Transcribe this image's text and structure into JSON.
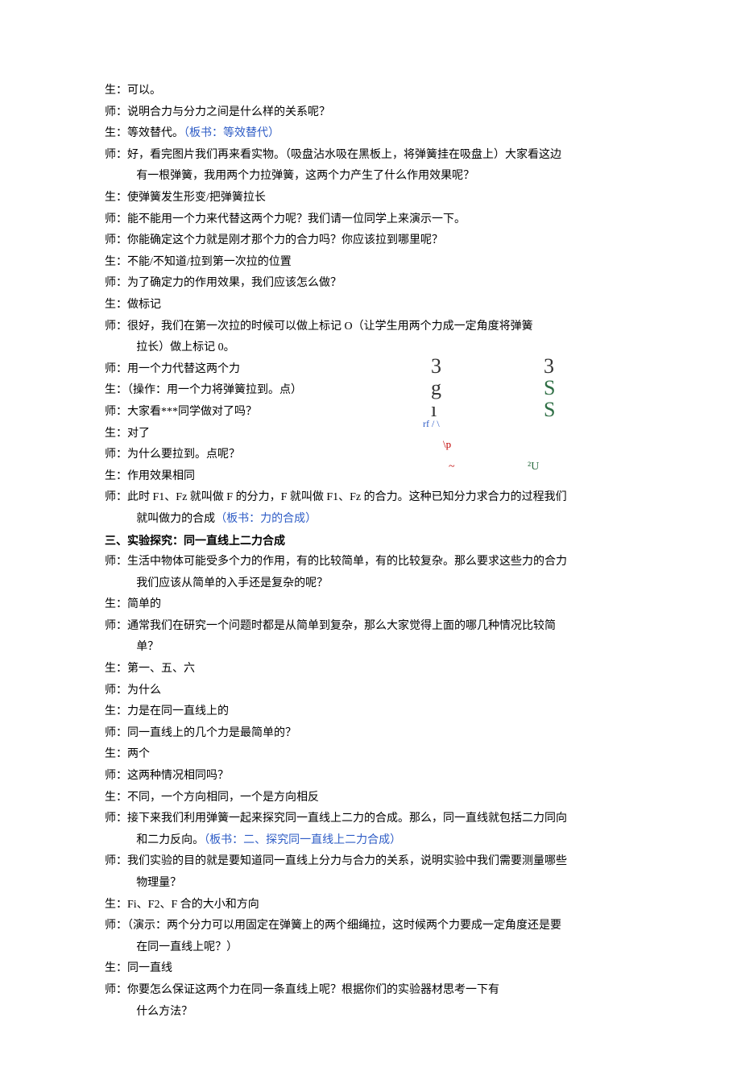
{
  "lines": [
    {
      "speaker": "生：",
      "text": "可以。"
    },
    {
      "speaker": "师：",
      "text": "说明合力与分力之间是什么样的关系呢？"
    },
    {
      "speaker": "生：",
      "text": "等效替代。",
      "blueSuffix": "（板书：等效替代）"
    },
    {
      "speaker": "师：",
      "text": "好，看完图片我们再来看实物。（吸盘沾水吸在黑板上，将弹簧挂在吸盘上）大家看这边"
    },
    {
      "indent": true,
      "text": "有一根弹簧，我用两个力拉弹簧，这两个力产生了什么作用效果呢？"
    },
    {
      "speaker": "生：",
      "text": "使弹簧发生形变/把弹簧拉长"
    },
    {
      "speaker": "师：",
      "text": "能不能用一个力来代替这两个力呢？我们请一位同学上来演示一下。"
    },
    {
      "speaker": "师：",
      "text": "你能确定这个力就是刚才那个力的合力吗？你应该拉到哪里呢？"
    },
    {
      "speaker": "生：",
      "text": "不能/不知道/拉到第一次拉的位置"
    },
    {
      "speaker": "师：",
      "text": "为了确定力的作用效果，我们应该怎么做？"
    },
    {
      "speaker": "生：",
      "text": "做标记"
    },
    {
      "speaker": "师：",
      "text": "很好，我们在第一次拉的时候可以做上标记 O（让学生用两个力成一定角度将弹簧"
    },
    {
      "indent": true,
      "text": "拉长）做上标记 0。"
    },
    {
      "speaker": "师：",
      "text": "用一个力代替这两个力"
    },
    {
      "speaker": "生：",
      "text": "（操作：用一个力将弹簧拉到。点）"
    },
    {
      "speaker": "师：",
      "text": "大家看***同学做对了吗？"
    },
    {
      "speaker": "生：",
      "text": "对了"
    },
    {
      "speaker": "师：",
      "text": "为什么要拉到。点呢？"
    },
    {
      "speaker": "生：",
      "text": "作用效果相同"
    },
    {
      "speaker": "师：",
      "text": "此时 F1、Fz 就叫做 F 的分力，F 就叫做 F1、Fz 的合力。这种已知分力求合力的过程我们"
    },
    {
      "indent": true,
      "text": "就叫做力的合成",
      "blueSuffix": "（板书：力的合成）"
    },
    {
      "heading": true,
      "text": "三、实验探究：同一直线上二力合成"
    },
    {
      "speaker": "师：",
      "text": "生活中物体可能受多个力的作用，有的比较简单，有的比较复杂。那么要求这些力的合力"
    },
    {
      "indent": true,
      "text": "我们应该从简单的入手还是复杂的呢？"
    },
    {
      "speaker": "生：",
      "text": "简单的"
    },
    {
      "speaker": "师：",
      "text": "通常我们在研究一个问题时都是从简单到复杂，那么大家觉得上面的哪几种情况比较简"
    },
    {
      "indent": true,
      "text": "单？"
    },
    {
      "speaker": "生：",
      "text": "第一、五、六"
    },
    {
      "speaker": "师：",
      "text": "为什么"
    },
    {
      "speaker": "生：",
      "text": "力是在同一直线上的"
    },
    {
      "speaker": "师：",
      "text": "同一直线上的几个力是最简单的？"
    },
    {
      "speaker": "生：",
      "text": "两个"
    },
    {
      "speaker": "师：",
      "text": "这两种情况相同吗？"
    },
    {
      "speaker": "生：",
      "text": "不同，一个方向相同，一个是方向相反"
    },
    {
      "speaker": "师：",
      "text": "接下来我们利用弹簧一起来探究同一直线上二力的合成。那么，同一直线就包括二力同向"
    },
    {
      "indent": true,
      "text": "和二力反向。",
      "blueSuffix": "（板书：二、探究同一直线上二力合成）"
    },
    {
      "speaker": "师：",
      "text": "我们实验的目的就是要知道同一直线上分力与合力的关系，说明实验中我们需要测量哪些"
    },
    {
      "indent": true,
      "text": "物理量？"
    },
    {
      "speaker": "生：",
      "text": "Fi、F2、F 合的大小和方向"
    },
    {
      "speaker": "师：",
      "text": "（演示：两个分力可以用固定在弹簧上的两个细绳拉，这时候两个力要成一定角度还是要"
    },
    {
      "indent": true,
      "text": "在同一直线上呢？）"
    },
    {
      "speaker": "生：",
      "text": "同一直线"
    },
    {
      "speaker": "师：",
      "text": "你要怎么保证这两个力在同一条直线上呢？根据你们的实验器材思考一下有"
    },
    {
      "indent": true,
      "text": "什么方法？"
    }
  ],
  "deco": {
    "c1": "3",
    "c2": "g",
    "c3": "ı",
    "c4": "rf / \\",
    "c5": "\\p",
    "c6": "~",
    "c7": "3",
    "c8": "S",
    "c9": "S",
    "c10": "²U"
  }
}
